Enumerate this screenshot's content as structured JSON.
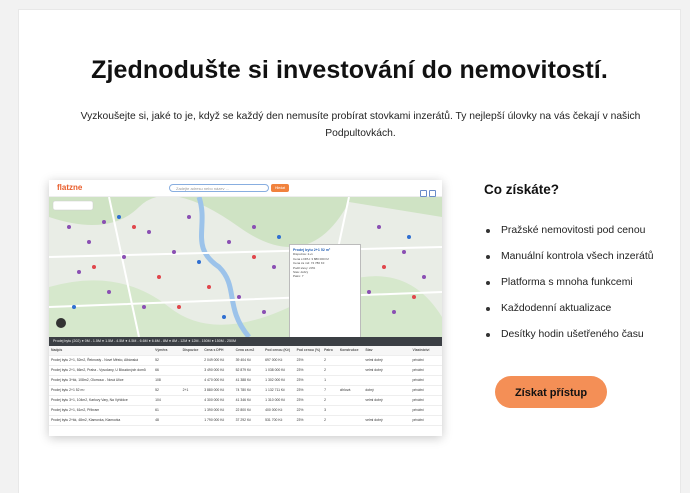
{
  "hero": {
    "title": "Zjednodušte si investování do nemovitostí.",
    "lead": "Vyzkoušejte si, jaké to je, když se každý den nemusíte probírat stovkami inzerátů. Ty nejlepší úlovky na vás čekají v našich Podpultovkách."
  },
  "preview": {
    "logo_main": "flatz",
    "logo_accent": "ne",
    "search_placeholder": "Zadejte adresu nebo název ...",
    "search_button": "Hledat",
    "legend": "Prodej bytu (202)  ● 0M - 1.5M  ● 1.5M - 4.5M  ● 4.5M - 6.6M  ● 6.6M - 8M  ● 8M - 12M  ● 12M - 150M  ● 150M - 250M",
    "popup_title": "Prodej bytu 2+1 52 m²",
    "popup_lines": [
      "Dispozice: 2+1",
      "Cena s DPH: 3 880 000 Kč",
      "Cena za m2: 74 780 Kč",
      "Podíl slevy: 23%",
      "Stav: dobrý",
      "Patro: 7"
    ],
    "table_headers": [
      "Nadpis",
      "Výměra",
      "Dispozice",
      "Cena s DPH",
      "Cena za m2",
      "Pod cenou (Kč)",
      "Pod cenou (%)",
      "Patro",
      "Konstrukce",
      "Stav",
      "Vlastnictví"
    ],
    "table_rows": [
      [
        "Prodej bytu 2+1, 52m2, Řeknosty - Nové Město, Albánská",
        "52",
        "",
        "2 049 000 Kč",
        "39 404 Kč",
        "697 000 Kč",
        "23%",
        "2",
        "",
        "velmi dobrý",
        "privátní"
      ],
      [
        "Prodej bytu 2+1, 66m2, Praha - Vysočany, U Bloudových domů",
        "66",
        "",
        "3 490 000 Kč",
        "52 879 Kč",
        "1 038 000 Kč",
        "23%",
        "2",
        "",
        "velmi dobrý",
        "privátní"
      ],
      [
        "Prodej bytu 3+kk, 108m2, Olomouc - Nová Ulice",
        "108",
        "",
        "4 470 000 Kč",
        "41 388 Kč",
        "1 302 000 Kč",
        "23%",
        "1",
        "",
        "",
        "privátní"
      ],
      [
        "Prodej bytu 2+1 52 m²",
        "52",
        "2+1",
        "3 880 000 Kč",
        "74 780 Kč",
        "1 132 711 Kč",
        "23%",
        "7",
        "cihlová",
        "dobrý",
        "privátní"
      ],
      [
        "Prodej bytu 3+1, 104m2, Karlovy Vary, Na Vyhlídce",
        "104",
        "",
        "4 300 000 Kč",
        "41 346 Kč",
        "1 310 000 Kč",
        "23%",
        "2",
        "",
        "velmi dobrý",
        "privátní"
      ],
      [
        "Prodej bytu 2+1, 61m2, Příbram",
        "61",
        "",
        "1 390 000 Kč",
        "22 800 Kč",
        "400 000 Kč",
        "22%",
        "3",
        "",
        "",
        "privátní"
      ],
      [
        "Prodej bytu 2+kk, 48m2, Klamovka, Klamovka",
        "48",
        "",
        "1 790 000 Kč",
        "37 292 Kč",
        "531 700 Kč",
        "23%",
        "2",
        "",
        "velmi dobrý",
        "privátní"
      ]
    ]
  },
  "benefits": {
    "title": "Co získáte?",
    "items": [
      "Pražské nemovitosti pod cenou",
      "Manuální kontrola všech inzerátů",
      "Platforma s mnoha funkcemi",
      "Každodenní aktualizace",
      "Desítky hodin ušetřeného času"
    ],
    "cta": "Získat přístup"
  },
  "colors": {
    "accent": "#f48f56",
    "brand_orange": "#e85c2a"
  }
}
